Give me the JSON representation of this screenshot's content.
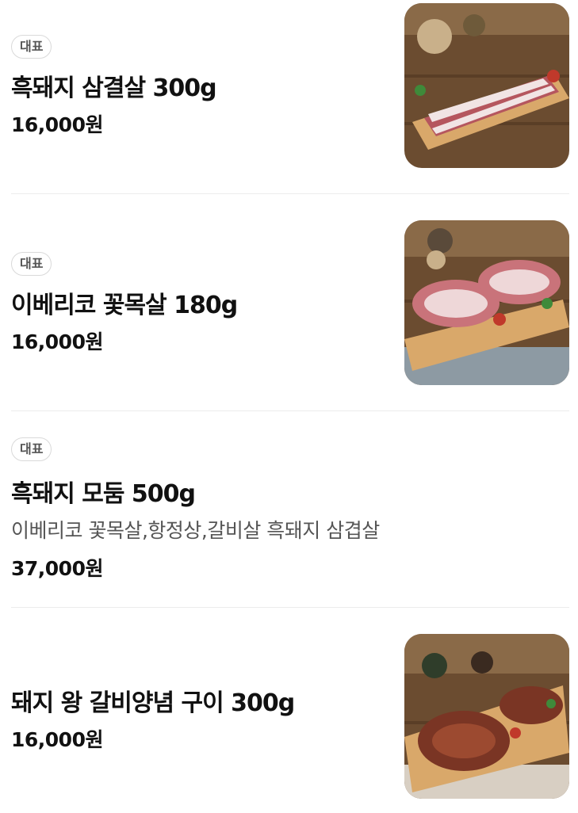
{
  "menu": {
    "items": [
      {
        "badge": "대표",
        "name": "흑돼지 삼결살 300g",
        "description": "",
        "price": "16,000원",
        "thumb_icon": "pork-belly-photo"
      },
      {
        "badge": "대표",
        "name": "이베리코 꽃목살 180g",
        "description": "",
        "price": "16,000원",
        "thumb_icon": "pork-neck-photo"
      },
      {
        "badge": "대표",
        "name": "흑돼지 모둠 500g",
        "description": "이베리코 꽃목살,항정상,갈비살 흑돼지 삼겹살",
        "price": "37,000원",
        "thumb_icon": ""
      },
      {
        "badge": "",
        "name": "돼지 왕 갈비양념 구이 300g",
        "description": "",
        "price": "16,000원",
        "thumb_icon": "marinated-rib-photo"
      }
    ]
  },
  "colors": {
    "badge_border": "#d9d9d9",
    "divider": "#ececec",
    "wood": "#7a5a3a",
    "board": "#d9a86a"
  }
}
